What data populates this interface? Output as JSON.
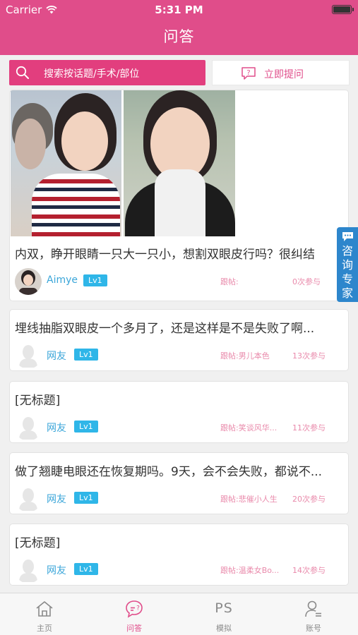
{
  "status_bar": {
    "carrier": "Carrier",
    "time": "5:31 PM"
  },
  "nav": {
    "title": "问答"
  },
  "search": {
    "placeholder": "搜索按话题/手术/部位",
    "ask_label": "立即提问"
  },
  "consult": {
    "label": "咨询专家"
  },
  "posts": [
    {
      "title": "内双，睁开眼睛一只大一只小，想割双眼皮行吗？很纠结",
      "user": "Aimye",
      "level": "Lv1",
      "follow": "跟帖:",
      "count": "0次参与"
    },
    {
      "title": "埋线抽脂双眼皮一个多月了，还是这样是不是失败了啊...",
      "user": "网友",
      "level": "Lv1",
      "follow": "跟帖:男儿本色",
      "count": "13次参与"
    },
    {
      "title": "[无标题]",
      "user": "网友",
      "level": "Lv1",
      "follow": "跟帖:笑谈风华...",
      "count": "11次参与"
    },
    {
      "title": "做了翘睫电眼还在恢复期吗。9天，会不会失败，都说不...",
      "user": "网友",
      "level": "Lv1",
      "follow": "跟帖:悲催小人生",
      "count": "20次参与"
    },
    {
      "title": "[无标题]",
      "user": "网友",
      "level": "Lv1",
      "follow": "跟帖:温柔女Bo...",
      "count": "14次参与"
    }
  ],
  "tabs": [
    {
      "label": "主页",
      "icon": "home-icon"
    },
    {
      "label": "问答",
      "icon": "chat-question-icon",
      "active": true
    },
    {
      "label": "模拟",
      "icon": "ps-text-icon",
      "glyph": "PS"
    },
    {
      "label": "账号",
      "icon": "user-icon"
    }
  ],
  "colors": {
    "brand_pink": "#e04d8a",
    "search_bg": "#e23e7e",
    "level_badge": "#2fb6e8",
    "consult_blue": "#2d86cc",
    "meta_pink": "#e98aab",
    "username_blue": "#3ba6d9"
  }
}
